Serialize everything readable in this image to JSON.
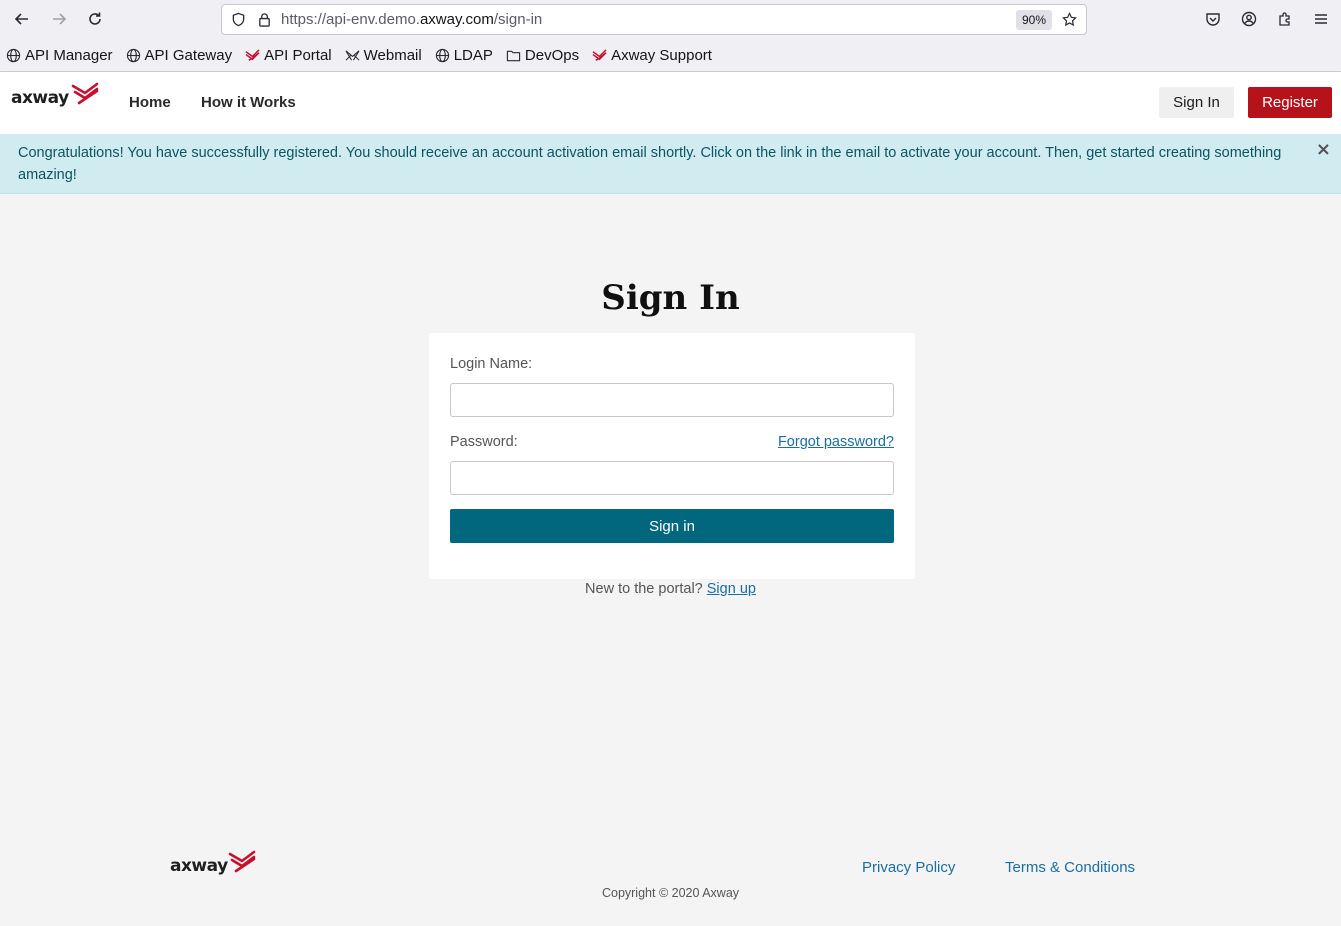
{
  "browser": {
    "url_prefix": "https://api-env.demo.",
    "url_domain": "axway.com",
    "url_path": "/sign-in",
    "zoom": "90%",
    "bookmarks": [
      {
        "label": "API Manager",
        "icon": "globe-icon"
      },
      {
        "label": "API Gateway",
        "icon": "globe-icon"
      },
      {
        "label": "API Portal",
        "icon": "axway-logo-icon"
      },
      {
        "label": "Webmail",
        "icon": "webmail-icon"
      },
      {
        "label": "LDAP",
        "icon": "globe-icon"
      },
      {
        "label": "DevOps",
        "icon": "folder-icon"
      },
      {
        "label": "Axway Support",
        "icon": "axway-logo-icon"
      }
    ]
  },
  "header": {
    "logo_text": "axway",
    "nav": [
      {
        "label": "Home"
      },
      {
        "label": "How it Works"
      }
    ],
    "signin_label": "Sign In",
    "register_label": "Register"
  },
  "alert": {
    "text": "Congratulations! You have successfully registered. You should receive an account activation email shortly. Click on the link in the email to activate your account. Then, get started creating something amazing!",
    "close": "×"
  },
  "signin": {
    "title": "Sign In",
    "login_label": "Login Name:",
    "login_value": "",
    "password_label": "Password:",
    "password_value": "",
    "forgot_label": "Forgot password?",
    "submit_label": "Sign in",
    "new_text": "New to the portal?",
    "signup_label": "Sign up"
  },
  "footer": {
    "logo_text": "axway",
    "privacy_label": "Privacy Policy",
    "terms_label": "Terms & Conditions",
    "copyright": "Copyright © 2020 Axway"
  },
  "colors": {
    "brand_red": "#b5121b",
    "primary_teal": "#00677f",
    "alert_bg": "#d1ecf1",
    "link": "#1a6ea0"
  }
}
